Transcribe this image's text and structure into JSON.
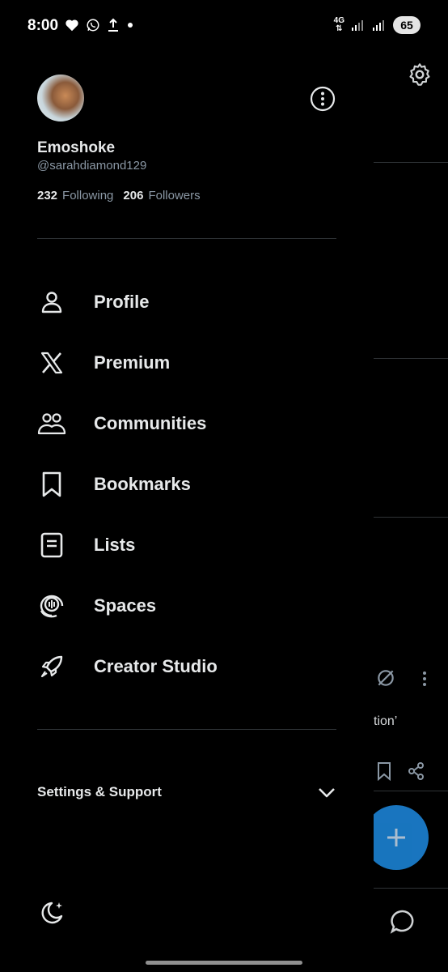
{
  "status_bar": {
    "time": "8:00",
    "network": "4G",
    "battery": "65"
  },
  "profile": {
    "display_name": "Emoshoke",
    "handle": "@sarahdiamond129",
    "following_count": "232",
    "following_label": "Following",
    "followers_count": "206",
    "followers_label": "Followers"
  },
  "menu": {
    "items": [
      {
        "label": "Profile",
        "icon": "person-icon"
      },
      {
        "label": "Premium",
        "icon": "x-logo-icon"
      },
      {
        "label": "Communities",
        "icon": "communities-icon"
      },
      {
        "label": "Bookmarks",
        "icon": "bookmark-icon"
      },
      {
        "label": "Lists",
        "icon": "list-icon"
      },
      {
        "label": "Spaces",
        "icon": "spaces-icon"
      },
      {
        "label": "Creator Studio",
        "icon": "rocket-icon"
      }
    ]
  },
  "settings": {
    "label": "Settings & Support"
  },
  "background": {
    "snippet": "tion’"
  },
  "colors": {
    "background": "#000000",
    "text": "#e7e9ea",
    "muted": "#8b98a5",
    "accent": "#1d8ae0",
    "divider": "#2f3336"
  }
}
